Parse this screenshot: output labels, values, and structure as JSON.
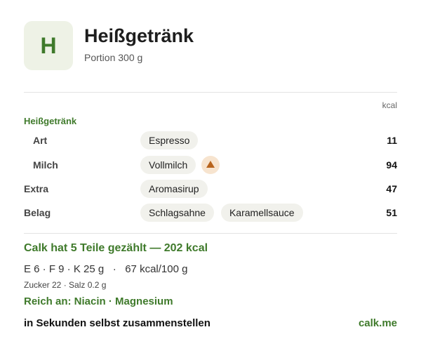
{
  "header": {
    "avatar_letter": "H",
    "title": "Heißgetränk",
    "subtitle": "Portion 300 g"
  },
  "table": {
    "unit_label": "kcal",
    "section_label": "Heißgetränk",
    "rows": [
      {
        "label": "Art",
        "pills": [
          "Espresso"
        ],
        "kcal": "11"
      },
      {
        "label": "Milch",
        "pills": [
          "Vollmilch"
        ],
        "warning_icon": "warning-triangle-icon",
        "kcal": "94"
      },
      {
        "label": "Extra",
        "pills": [
          "Aromasirup"
        ],
        "kcal": "47"
      },
      {
        "label": "Belag",
        "pills": [
          "Schlagsahne",
          "Karamellsauce"
        ],
        "kcal": "51"
      }
    ]
  },
  "summary": {
    "headline": "Calk hat 5 Teile gezählt — 202 kcal",
    "nutrients": "E 6 · F 9 · K 25 g   ·   67 kcal/100 g",
    "minor": "Zucker 22 · Salz 0.2 g",
    "rich_in": "Reich an: Niacin · Magnesium"
  },
  "footer": {
    "cta": "in Sekunden selbst zusammenstellen",
    "brand": "calk.me"
  },
  "colors": {
    "accent_green": "#3f7a2b",
    "avatar_bg": "#eef2e6",
    "pill_bg": "#f1f1ec",
    "warning_bg": "#f7e4cf",
    "warning_fg": "#b8641d"
  }
}
